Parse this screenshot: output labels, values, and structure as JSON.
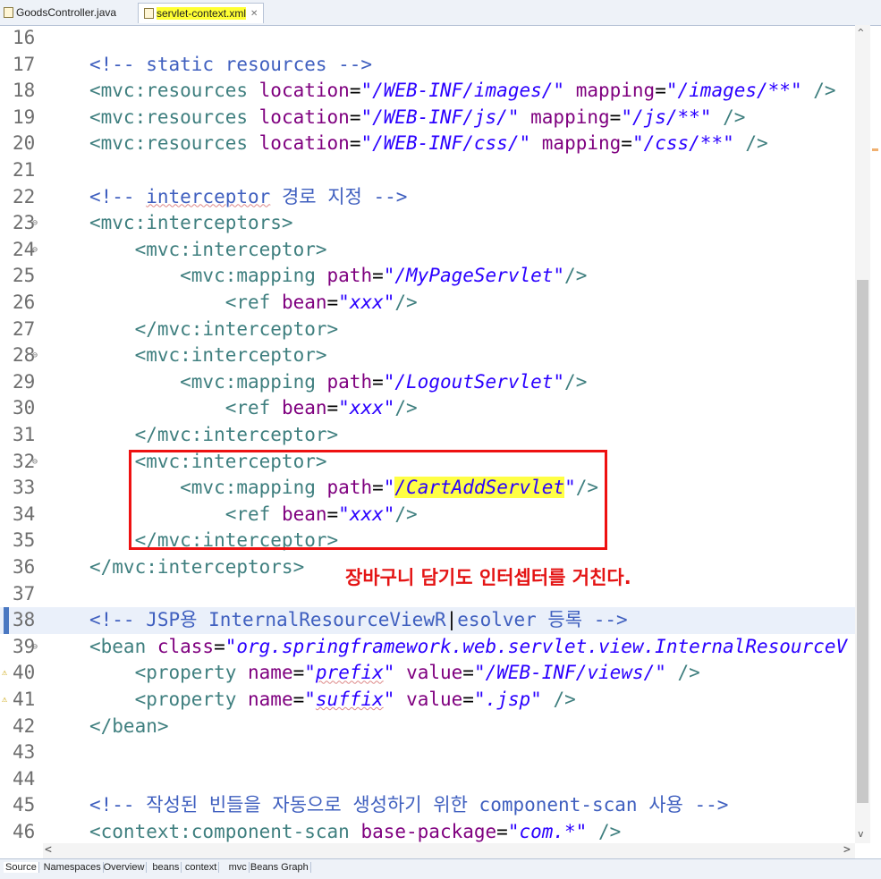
{
  "tabs": [
    {
      "label": "GoodsController.java",
      "active": false
    },
    {
      "label": "servlet-context.xml",
      "active": true,
      "close": "✕"
    }
  ],
  "lines": [
    {
      "num": "16",
      "segs": []
    },
    {
      "num": "17",
      "segs": [
        {
          "t": "<!-- static resources -->",
          "c": "cmt"
        }
      ]
    },
    {
      "num": "18",
      "segs": [
        {
          "t": "<mvc:resources ",
          "c": "tag"
        },
        {
          "t": "location",
          "c": "attr"
        },
        {
          "t": "=",
          "c": "plain"
        },
        {
          "t": "\"/WEB-INF/images/\"",
          "c": "str"
        },
        {
          "t": " ",
          "c": "plain"
        },
        {
          "t": "mapping",
          "c": "attr"
        },
        {
          "t": "=",
          "c": "plain"
        },
        {
          "t": "\"/images/**\"",
          "c": "str"
        },
        {
          "t": " />",
          "c": "tag"
        }
      ]
    },
    {
      "num": "19",
      "segs": [
        {
          "t": "<mvc:resources ",
          "c": "tag"
        },
        {
          "t": "location",
          "c": "attr"
        },
        {
          "t": "=",
          "c": "plain"
        },
        {
          "t": "\"/WEB-INF/js/\"",
          "c": "str"
        },
        {
          "t": " ",
          "c": "plain"
        },
        {
          "t": "mapping",
          "c": "attr"
        },
        {
          "t": "=",
          "c": "plain"
        },
        {
          "t": "\"/js/**\"",
          "c": "str"
        },
        {
          "t": " />",
          "c": "tag"
        }
      ]
    },
    {
      "num": "20",
      "segs": [
        {
          "t": "<mvc:resources ",
          "c": "tag"
        },
        {
          "t": "location",
          "c": "attr"
        },
        {
          "t": "=",
          "c": "plain"
        },
        {
          "t": "\"/WEB-INF/css/\"",
          "c": "str"
        },
        {
          "t": " ",
          "c": "plain"
        },
        {
          "t": "mapping",
          "c": "attr"
        },
        {
          "t": "=",
          "c": "plain"
        },
        {
          "t": "\"/css/**\"",
          "c": "str"
        },
        {
          "t": " />",
          "c": "tag"
        }
      ]
    },
    {
      "num": "21",
      "segs": []
    },
    {
      "num": "22",
      "segs": [
        {
          "t": "<!-- ",
          "c": "cmt"
        },
        {
          "t": "interceptor",
          "c": "cmt squig"
        },
        {
          "t": " 경로 지정 -->",
          "c": "cmt"
        }
      ]
    },
    {
      "num": "23",
      "fold": true,
      "segs": [
        {
          "t": "<mvc:interceptors>",
          "c": "tag"
        }
      ]
    },
    {
      "num": "24",
      "fold": true,
      "segs": [
        {
          "t": "    <mvc:interceptor>",
          "c": "tag"
        }
      ]
    },
    {
      "num": "25",
      "segs": [
        {
          "t": "        <mvc:mapping ",
          "c": "tag"
        },
        {
          "t": "path",
          "c": "attr"
        },
        {
          "t": "=",
          "c": "plain"
        },
        {
          "t": "\"/MyPageServlet\"",
          "c": "str"
        },
        {
          "t": "/>",
          "c": "tag"
        }
      ]
    },
    {
      "num": "26",
      "segs": [
        {
          "t": "            <ref ",
          "c": "tag"
        },
        {
          "t": "bean",
          "c": "attr"
        },
        {
          "t": "=",
          "c": "plain"
        },
        {
          "t": "\"xxx\"",
          "c": "str"
        },
        {
          "t": "/>",
          "c": "tag"
        }
      ]
    },
    {
      "num": "27",
      "segs": [
        {
          "t": "    </mvc:interceptor>",
          "c": "tag"
        }
      ]
    },
    {
      "num": "28",
      "fold": true,
      "segs": [
        {
          "t": "    <mvc:interceptor>",
          "c": "tag"
        }
      ]
    },
    {
      "num": "29",
      "segs": [
        {
          "t": "        <mvc:mapping ",
          "c": "tag"
        },
        {
          "t": "path",
          "c": "attr"
        },
        {
          "t": "=",
          "c": "plain"
        },
        {
          "t": "\"/LogoutServlet\"",
          "c": "str"
        },
        {
          "t": "/>",
          "c": "tag"
        }
      ]
    },
    {
      "num": "30",
      "segs": [
        {
          "t": "            <ref ",
          "c": "tag"
        },
        {
          "t": "bean",
          "c": "attr"
        },
        {
          "t": "=",
          "c": "plain"
        },
        {
          "t": "\"xxx\"",
          "c": "str"
        },
        {
          "t": "/>",
          "c": "tag"
        }
      ]
    },
    {
      "num": "31",
      "segs": [
        {
          "t": "    </mvc:interceptor>",
          "c": "tag"
        }
      ]
    },
    {
      "num": "32",
      "fold": true,
      "segs": [
        {
          "t": "    <mvc:interceptor>",
          "c": "tag"
        }
      ]
    },
    {
      "num": "33",
      "segs": [
        {
          "t": "        <mvc:mapping ",
          "c": "tag"
        },
        {
          "t": "path",
          "c": "attr"
        },
        {
          "t": "=",
          "c": "plain"
        },
        {
          "t": "\"",
          "c": "str"
        },
        {
          "t": "/CartAddServlet",
          "c": "str hl"
        },
        {
          "t": "\"",
          "c": "str"
        },
        {
          "t": "/>",
          "c": "tag"
        }
      ]
    },
    {
      "num": "34",
      "segs": [
        {
          "t": "            <ref ",
          "c": "tag"
        },
        {
          "t": "bean",
          "c": "attr"
        },
        {
          "t": "=",
          "c": "plain"
        },
        {
          "t": "\"xxx\"",
          "c": "str"
        },
        {
          "t": "/>",
          "c": "tag"
        }
      ]
    },
    {
      "num": "35",
      "segs": [
        {
          "t": "    </mvc:interceptor>",
          "c": "tag"
        }
      ]
    },
    {
      "num": "36",
      "segs": [
        {
          "t": "</mvc:interceptors>",
          "c": "tag"
        }
      ]
    },
    {
      "num": "37",
      "segs": []
    },
    {
      "num": "38",
      "current": true,
      "segs": [
        {
          "t": "<!-- JSP용 InternalResourceViewR",
          "c": "cmt"
        },
        {
          "t": "|",
          "c": "plain"
        },
        {
          "t": "esolver 등록 -->",
          "c": "cmt"
        }
      ]
    },
    {
      "num": "39",
      "fold": true,
      "segs": [
        {
          "t": "<bean ",
          "c": "tag"
        },
        {
          "t": "class",
          "c": "attr"
        },
        {
          "t": "=",
          "c": "plain"
        },
        {
          "t": "\"org.springframework.web.servlet.view.InternalResourceV",
          "c": "str"
        }
      ]
    },
    {
      "num": "40",
      "warn": true,
      "segs": [
        {
          "t": "    <property ",
          "c": "tag"
        },
        {
          "t": "name",
          "c": "attr"
        },
        {
          "t": "=",
          "c": "plain"
        },
        {
          "t": "\"",
          "c": "str"
        },
        {
          "t": "prefix",
          "c": "str squig"
        },
        {
          "t": "\"",
          "c": "str"
        },
        {
          "t": " ",
          "c": "plain"
        },
        {
          "t": "value",
          "c": "attr"
        },
        {
          "t": "=",
          "c": "plain"
        },
        {
          "t": "\"/WEB-INF/views/\"",
          "c": "str"
        },
        {
          "t": " />",
          "c": "tag"
        }
      ]
    },
    {
      "num": "41",
      "warn": true,
      "segs": [
        {
          "t": "    <property ",
          "c": "tag"
        },
        {
          "t": "name",
          "c": "attr"
        },
        {
          "t": "=",
          "c": "plain"
        },
        {
          "t": "\"",
          "c": "str"
        },
        {
          "t": "suffix",
          "c": "str squig"
        },
        {
          "t": "\"",
          "c": "str"
        },
        {
          "t": " ",
          "c": "plain"
        },
        {
          "t": "value",
          "c": "attr"
        },
        {
          "t": "=",
          "c": "plain"
        },
        {
          "t": "\".jsp\"",
          "c": "str"
        },
        {
          "t": " />",
          "c": "tag"
        }
      ]
    },
    {
      "num": "42",
      "segs": [
        {
          "t": "</bean>",
          "c": "tag"
        }
      ]
    },
    {
      "num": "43",
      "segs": []
    },
    {
      "num": "44",
      "segs": []
    },
    {
      "num": "45",
      "segs": [
        {
          "t": "<!-- 작성된 빈들을 자동으로 생성하기 위한 component-scan 사용 -->",
          "c": "cmt"
        }
      ]
    },
    {
      "num": "46",
      "segs": [
        {
          "t": "<context:component-scan ",
          "c": "tag"
        },
        {
          "t": "base-package",
          "c": "attr"
        },
        {
          "t": "=",
          "c": "plain"
        },
        {
          "t": "\"com.*\"",
          "c": "str"
        },
        {
          "t": " />",
          "c": "tag"
        }
      ]
    }
  ],
  "annotation": "장바구니 담기도 인터셉터를 거친다.",
  "bottom_tabs": [
    "Source",
    "Namespaces",
    "Overview",
    "beans",
    "context",
    "mvc",
    "Beans Graph"
  ],
  "scroll": {
    "up": "^",
    "down": "v",
    "left": "<",
    "right": ">"
  }
}
